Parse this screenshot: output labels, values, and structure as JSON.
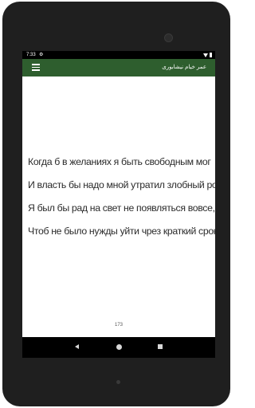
{
  "status_bar": {
    "time": "7:33",
    "settings_icon": "gear-icon",
    "wifi_icon": "wifi-icon",
    "battery_icon": "battery-icon"
  },
  "app_bar": {
    "title": "عمر خیام نیشابوری",
    "menu_icon": "hamburger-menu-icon",
    "color": "#2e5e2e"
  },
  "poem": {
    "lines": [
      "Когда б в желаниях я быть свободным мог",
      "И власть бы надо мной утратил злобный рок,",
      "Я был бы рад на свет не появляться вовсе,",
      "Чтоб не было нужды уйти чрез краткий срок."
    ]
  },
  "page_number": "173",
  "nav_bar": {
    "back_icon": "back-triangle-icon",
    "home_icon": "home-circle-icon",
    "recents_icon": "recents-square-icon"
  }
}
